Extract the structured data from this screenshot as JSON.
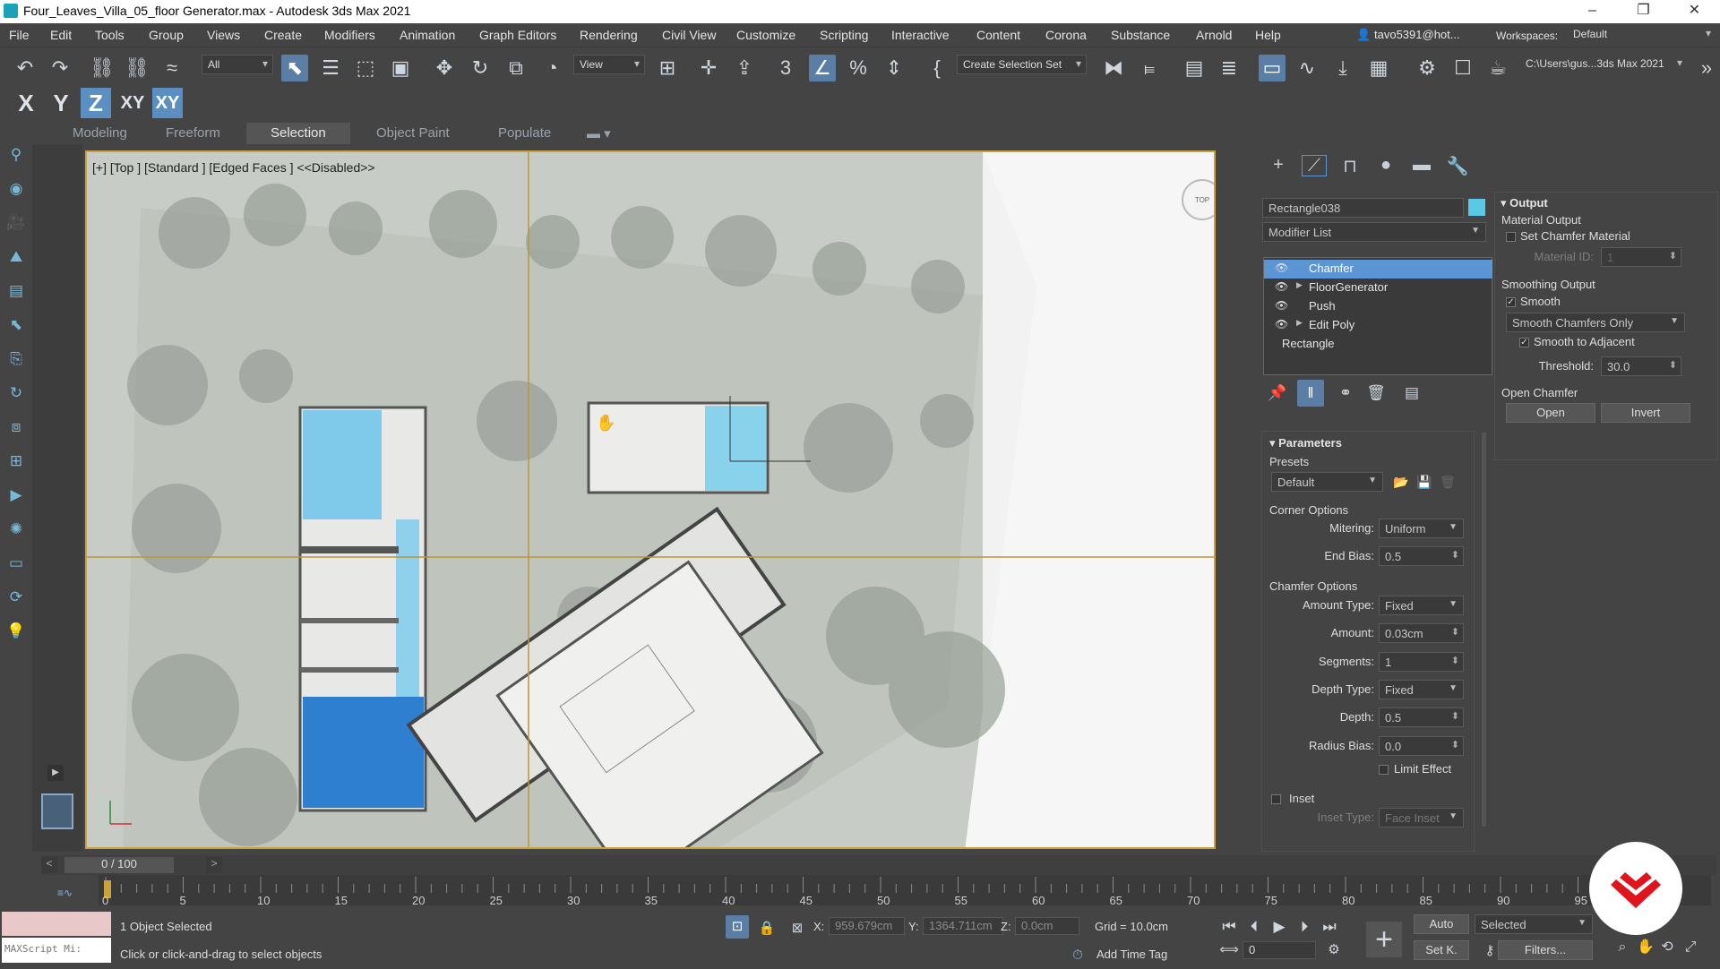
{
  "window": {
    "title": "Four_Leaves_Villa_05_floor Generator.max - Autodesk 3ds Max 2021",
    "controls": [
      "–",
      "❐",
      "✕"
    ]
  },
  "menu": {
    "items": [
      "File",
      "Edit",
      "Tools",
      "Group",
      "Views",
      "Create",
      "Modifiers",
      "Animation",
      "Graph Editors",
      "Rendering",
      "Civil View",
      "Customize",
      "Scripting",
      "Interactive",
      "Content",
      "Corona",
      "Substance",
      "Arnold",
      "Help"
    ],
    "user": "tavo5391@hot...",
    "workspaces_label": "Workspaces:",
    "workspace_value": "Default"
  },
  "toolbar": {
    "selection_filter": "All",
    "ref_coord": "View",
    "selection_set": "Create Selection Set",
    "project_path": "C:\\Users\\gus...3ds Max 2021",
    "axis_buttons": [
      "X",
      "Y",
      "Z",
      "XY",
      "XY"
    ]
  },
  "ribbon": {
    "tabs": [
      "Modeling",
      "Freeform",
      "Selection",
      "Object Paint",
      "Populate"
    ],
    "active": "Selection"
  },
  "viewport": {
    "label": "[+] [Top ] [Standard ] [Edged Faces ]  <<Disabled>>",
    "viewcube": "TOP",
    "background": "#c8ccc6"
  },
  "command_panel": {
    "object_name": "Rectangle038",
    "object_color": "#5bc8e8",
    "modifier_list": "Modifier List",
    "stack": [
      {
        "label": "Chamfer",
        "eye": true,
        "expand": false,
        "selected": true
      },
      {
        "label": "FloorGenerator",
        "eye": true,
        "expand": true,
        "selected": false
      },
      {
        "label": "Push",
        "eye": true,
        "expand": false,
        "selected": false
      },
      {
        "label": "Edit Poly",
        "eye": true,
        "expand": true,
        "selected": false
      },
      {
        "label": "Rectangle",
        "eye": false,
        "expand": false,
        "selected": false
      }
    ],
    "parameters": {
      "title": "Parameters",
      "presets_label": "Presets",
      "preset_value": "Default",
      "corner_options": "Corner Options",
      "mitering_label": "Mitering:",
      "mitering_value": "Uniform",
      "end_bias_label": "End Bias:",
      "end_bias_value": "0.5",
      "chamfer_options": "Chamfer Options",
      "amount_type_label": "Amount Type:",
      "amount_type_value": "Fixed",
      "amount_label": "Amount:",
      "amount_value": "0.03cm",
      "segments_label": "Segments:",
      "segments_value": "1",
      "depth_type_label": "Depth Type:",
      "depth_type_value": "Fixed",
      "depth_label": "Depth:",
      "depth_value": "0.5",
      "radius_bias_label": "Radius Bias:",
      "radius_bias_value": "0.0",
      "limit_effect": "Limit Effect",
      "inset": "Inset",
      "inset_type_label": "Inset Type:",
      "inset_type_value": "Face Inset"
    },
    "output": {
      "title": "Output",
      "material_output": "Material Output",
      "set_chamfer_material": "Set Chamfer Material",
      "material_id_label": "Material ID:",
      "material_id_value": "1",
      "smoothing_output": "Smoothing Output",
      "smooth": "Smooth",
      "smooth_checked": true,
      "smooth_mode": "Smooth Chamfers Only",
      "smooth_to_adjacent": "Smooth to Adjacent",
      "smooth_to_adjacent_checked": true,
      "threshold_label": "Threshold:",
      "threshold_value": "30.0",
      "open_chamfer": "Open Chamfer",
      "open_btn": "Open",
      "invert_btn": "Invert"
    }
  },
  "timeline": {
    "frame_display": "0 / 100",
    "tick_labels": [
      "0",
      "5",
      "10",
      "15",
      "20",
      "25",
      "30",
      "35",
      "40",
      "45",
      "50",
      "55",
      "60",
      "65",
      "70",
      "75",
      "80",
      "85",
      "90",
      "95"
    ]
  },
  "status": {
    "maxscript": "MAXScript Mi:",
    "selected_count": "1 Object Selected",
    "prompt": "Click or click-and-drag to select objects",
    "x_label": "X:",
    "x_value": "959.679cm",
    "y_label": "Y:",
    "y_value": "1364.711cm",
    "z_label": "Z:",
    "z_value": "0.0cm",
    "grid": "Grid = 10.0cm",
    "add_time_tag": "Add Time Tag",
    "auto_key": "Auto",
    "set_key": "Set K.",
    "key_mode": "Selected",
    "filters": "Filters...",
    "current_frame": "0"
  }
}
